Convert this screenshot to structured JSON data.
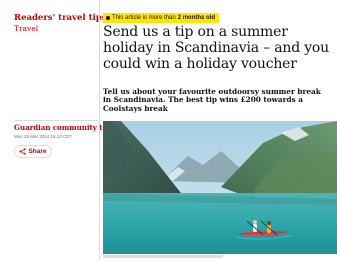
{
  "sidebar": {
    "section_title": "Readers' travel tips",
    "section_sub": "Travel",
    "byline": "Guardian community team",
    "timestamp": "Mon 25 Mar 2024 16.13 CET",
    "share_label": "Share",
    "share_icon": "share-icon"
  },
  "article": {
    "age_badge_prefix": "This article is more than",
    "age_badge_bold": "2 months old",
    "headline": "Send us a tip on a summer holiday in Scandinavia – and you could win a holiday voucher",
    "standfirst": "Tell us about your favourite outdoorsy summer break in Scandinavia. The best tip wins £200 towards a Coolstays break"
  },
  "colors": {
    "brand_red": "#c70000",
    "badge_yellow": "#ffe500",
    "text": "#121212"
  }
}
